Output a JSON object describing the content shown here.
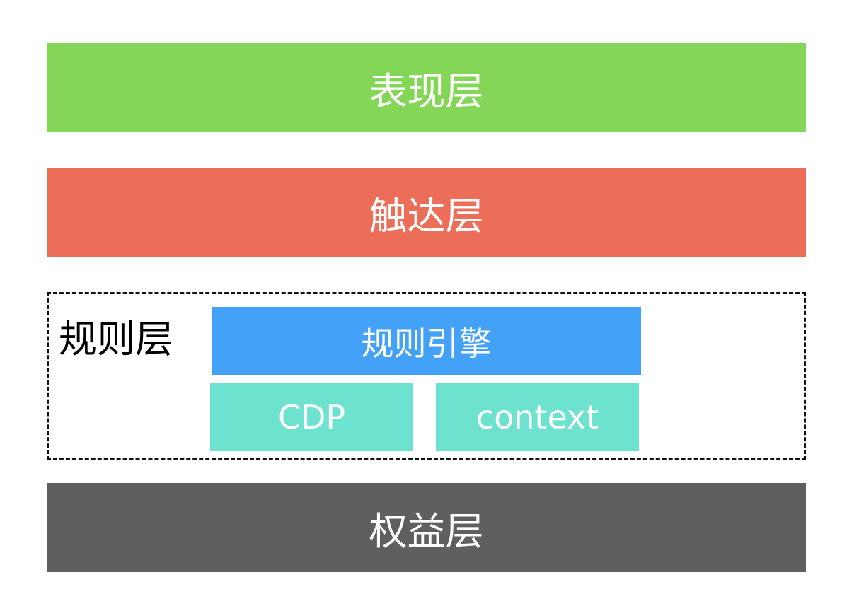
{
  "layers": {
    "presentation": {
      "label": "表现层",
      "color": "#83d656"
    },
    "reach": {
      "label": "触达层",
      "color": "#ed6e58"
    },
    "rule": {
      "label": "规则层",
      "engine": {
        "label": "规则引擎",
        "color": "#44a1f8"
      },
      "cdp": {
        "label": "CDP",
        "color": "#6ce2cf"
      },
      "context": {
        "label": "context",
        "color": "#6ce2cf"
      }
    },
    "benefit": {
      "label": "权益层",
      "color": "#5f5f5f"
    }
  }
}
